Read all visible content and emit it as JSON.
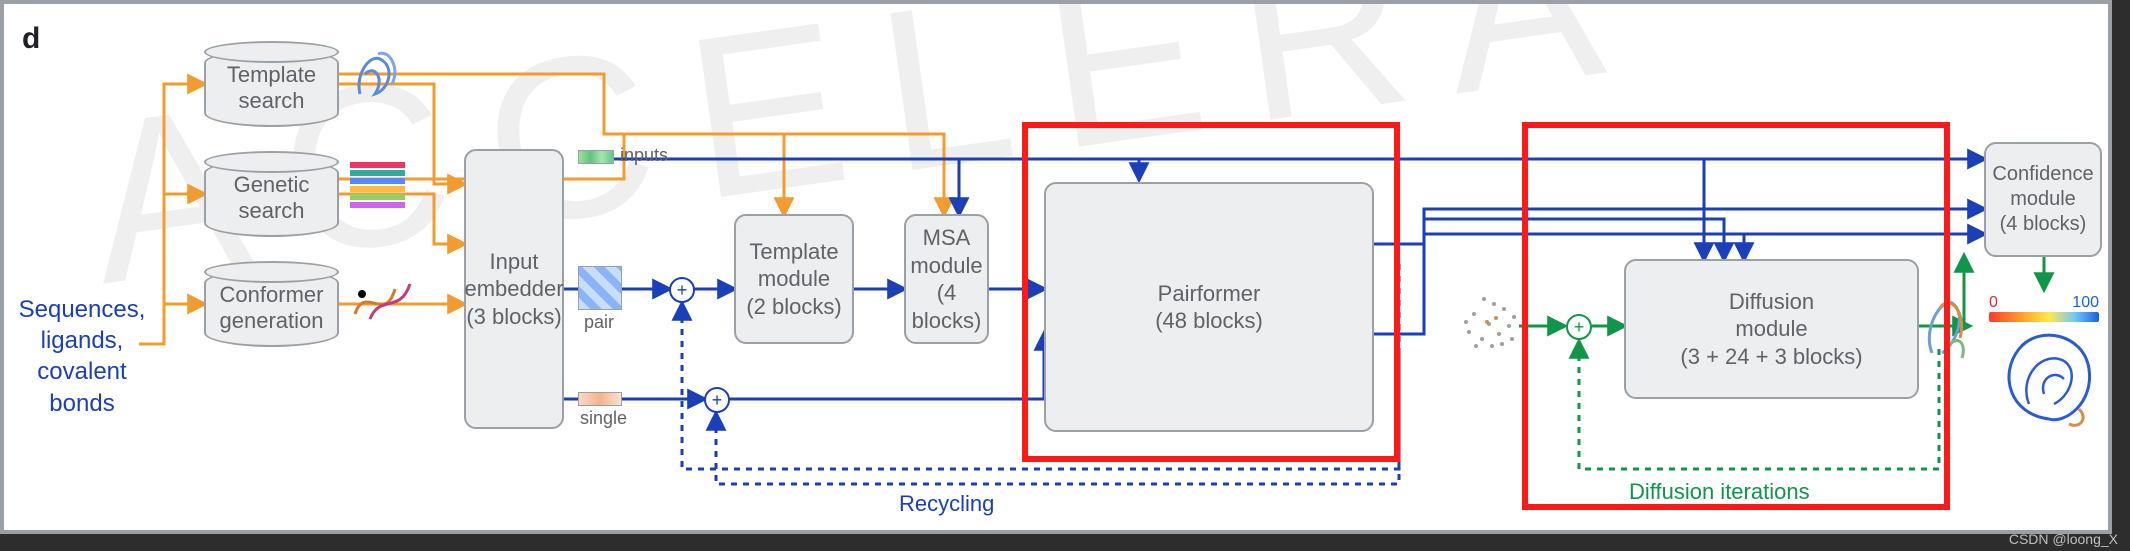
{
  "panel_letter": "d",
  "input_text": "Sequences,\nligands,\ncovalent\nbonds",
  "cylinders": {
    "template": "Template\nsearch",
    "genetic": "Genetic\nsearch",
    "conformer": "Conformer\ngeneration"
  },
  "embedder": {
    "title": "Input\nembedder",
    "sub": "(3 blocks)"
  },
  "tensor_labels": {
    "inputs": "inputs",
    "pair": "pair",
    "single": "single"
  },
  "template_module": {
    "title": "Template\nmodule",
    "sub": "(2 blocks)"
  },
  "msa_module": {
    "title": "MSA\nmodule",
    "sub": "(4 blocks)"
  },
  "pairformer": {
    "title": "Pairformer",
    "sub": "(48 blocks)"
  },
  "diffusion": {
    "title": "Diffusion\nmodule",
    "sub": "(3 + 24 + 3 blocks)"
  },
  "confidence": {
    "title": "Confidence\nmodule",
    "sub": "(4 blocks)"
  },
  "loops": {
    "recycling": "Recycling",
    "diffusion": "Diffusion iterations"
  },
  "scale": {
    "min": "0",
    "max": "100"
  },
  "watermarks": {
    "accel": "ACCELERA",
    "csdn": "CSDN @loong_X"
  }
}
